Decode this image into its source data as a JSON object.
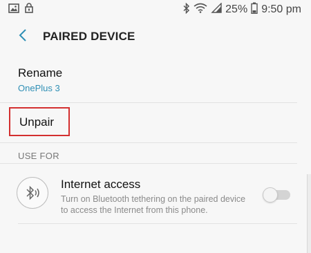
{
  "status_bar": {
    "battery": "25%",
    "time": "9:50 pm"
  },
  "app_bar": {
    "title": "PAIRED DEVICE"
  },
  "rename": {
    "label": "Rename",
    "device_name": "OnePlus 3"
  },
  "unpair": {
    "label": "Unpair"
  },
  "use_for": {
    "header": "USE FOR",
    "internet": {
      "title": "Internet access",
      "description": "Turn on Bluetooth tethering on the paired device to access the Internet from this phone.",
      "enabled": false
    }
  },
  "colors": {
    "accent": "#2f8fb5",
    "highlight_box": "#d32f2f",
    "background": "#f7f7f7"
  }
}
